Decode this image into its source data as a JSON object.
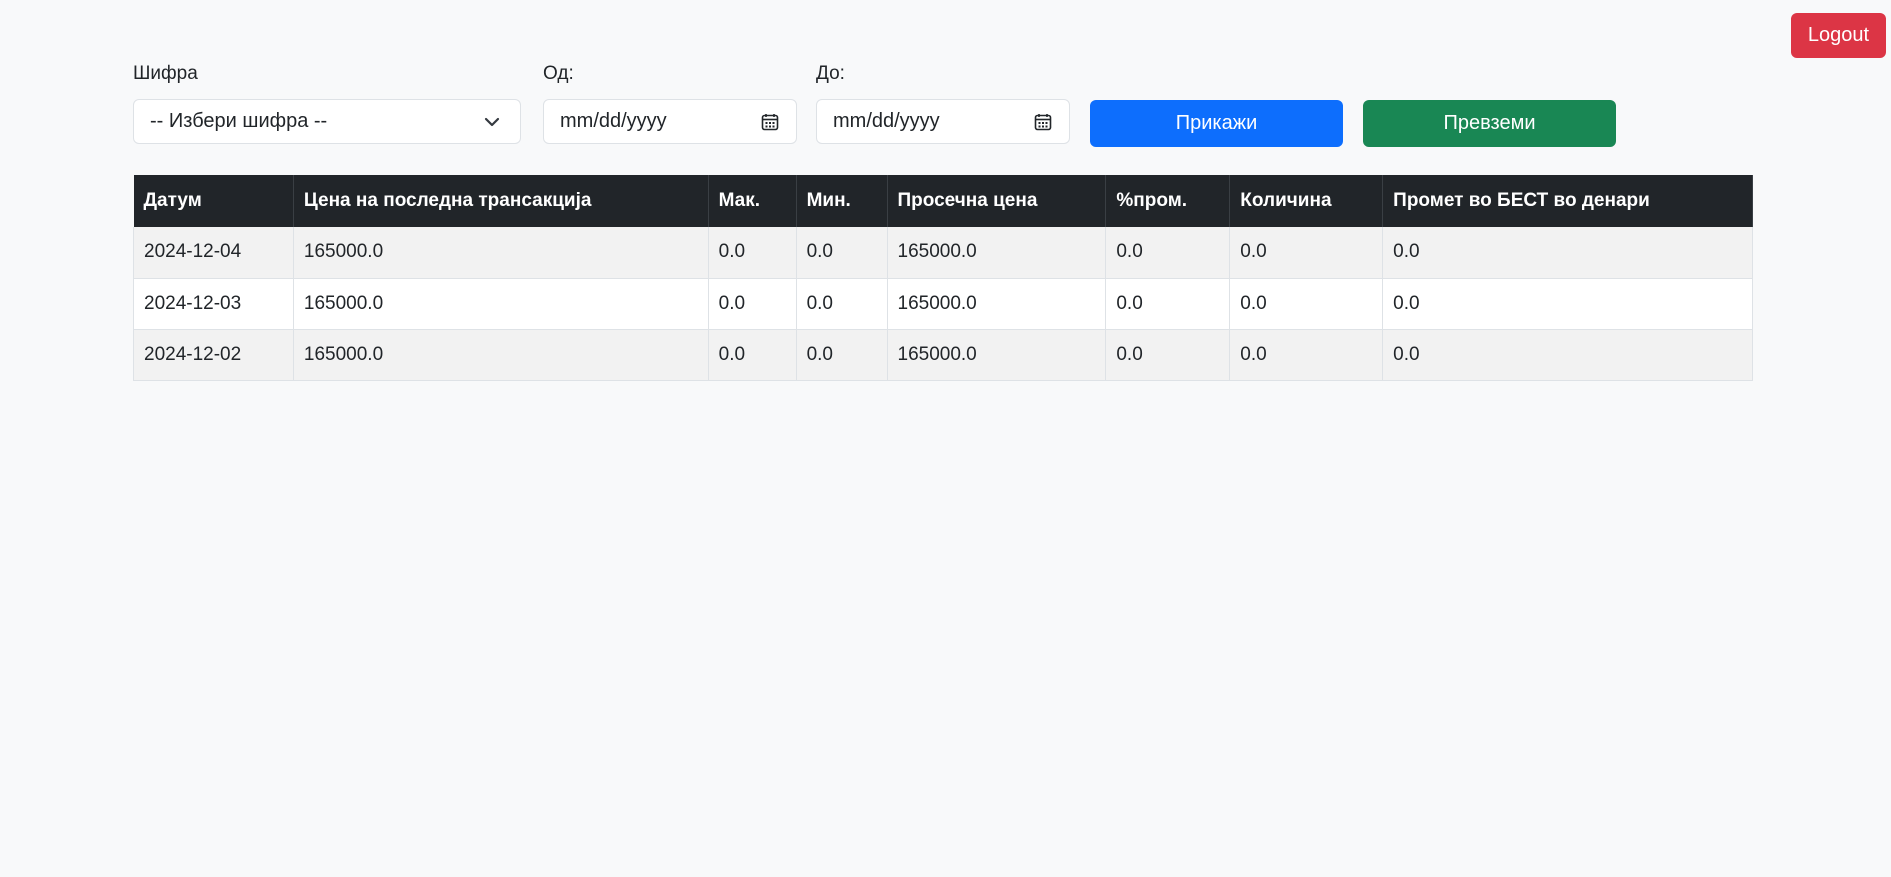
{
  "header": {
    "logout_label": "Logout"
  },
  "filters": {
    "symbol_label": "Шифра",
    "symbol_value": "-- Избери шифра --",
    "from_label": "Од:",
    "from_placeholder": "mm/dd/yyyy",
    "to_label": "До:",
    "to_placeholder": "mm/dd/yyyy",
    "show_button": "Прикажи",
    "download_button": "Превземи"
  },
  "table": {
    "columns": [
      "Датум",
      "Цена на последна трансакција",
      "Мак.",
      "Мин.",
      "Просечна цена",
      "%пром.",
      "Количина",
      "Промет во БЕСТ во денари"
    ],
    "rows": [
      [
        "2024-12-04",
        "165000.0",
        "0.0",
        "0.0",
        "165000.0",
        "0.0",
        "0.0",
        "0.0"
      ],
      [
        "2024-12-03",
        "165000.0",
        "0.0",
        "0.0",
        "165000.0",
        "0.0",
        "0.0",
        "0.0"
      ],
      [
        "2024-12-02",
        "165000.0",
        "0.0",
        "0.0",
        "165000.0",
        "0.0",
        "0.0",
        "0.0"
      ]
    ]
  },
  "colors": {
    "primary": "#0d6efd",
    "success": "#198754",
    "danger": "#dc3545",
    "header_dark": "#212529"
  },
  "icons": {
    "select": "chevron-down-icon",
    "date": "calendar-icon"
  }
}
